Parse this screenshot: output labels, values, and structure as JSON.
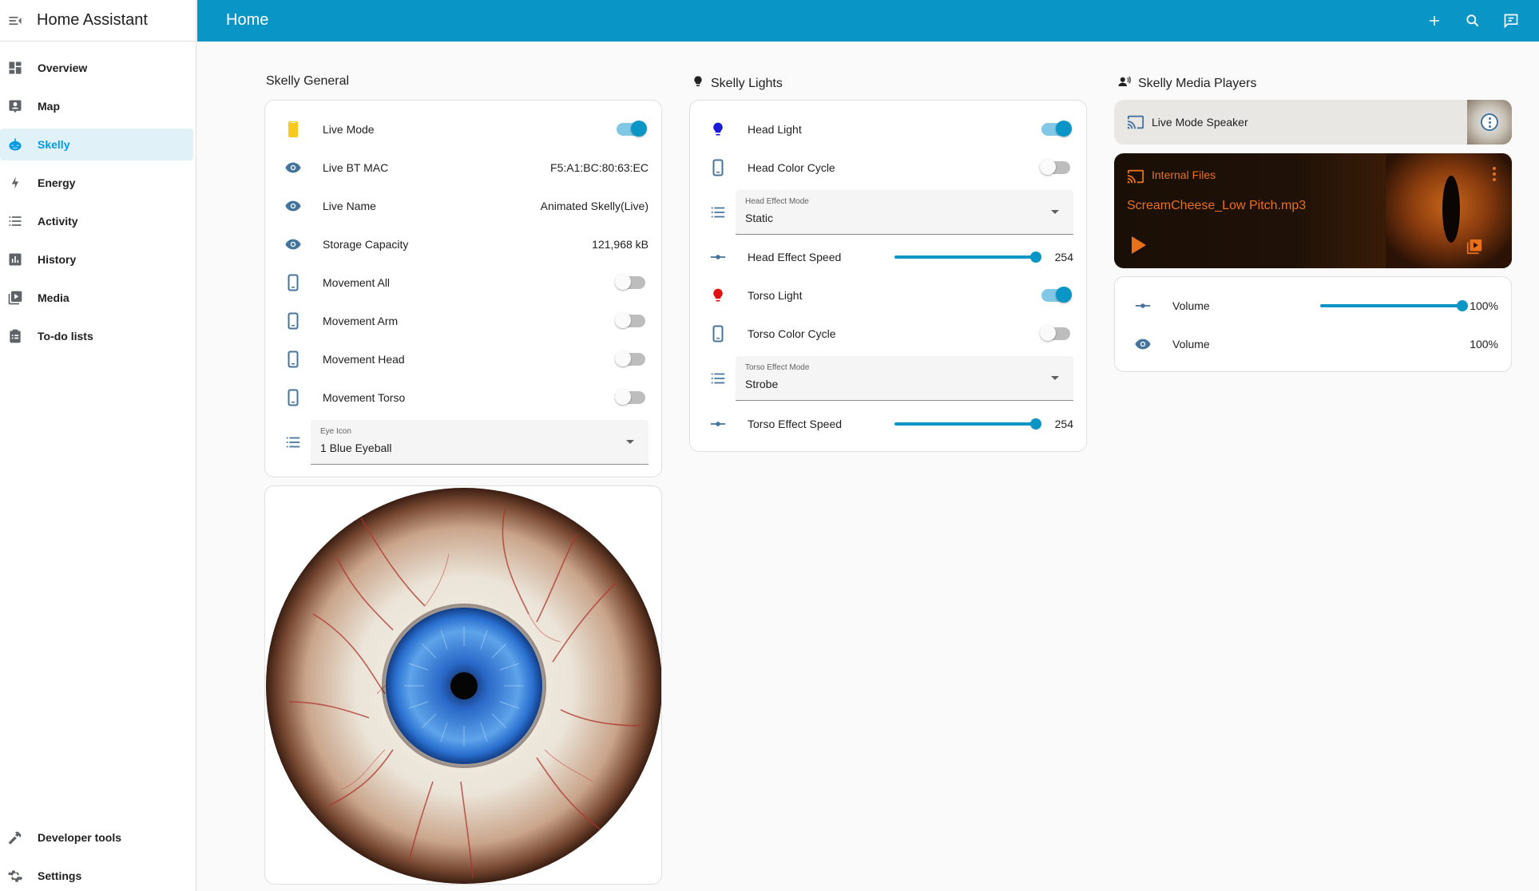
{
  "app": {
    "title": "Home Assistant"
  },
  "header": {
    "title": "Home"
  },
  "sidebar": {
    "items": [
      {
        "label": "Overview",
        "icon": "view-dashboard-icon"
      },
      {
        "label": "Map",
        "icon": "map-account-icon"
      },
      {
        "label": "Skelly",
        "icon": "pumpkin-icon",
        "active": true
      },
      {
        "label": "Energy",
        "icon": "lightning-bolt-icon"
      },
      {
        "label": "Activity",
        "icon": "format-list-bulleted-icon"
      },
      {
        "label": "History",
        "icon": "chart-box-icon"
      },
      {
        "label": "Media",
        "icon": "play-box-multiple-icon"
      },
      {
        "label": "To-do lists",
        "icon": "clipboard-list-icon"
      }
    ],
    "bottom": [
      {
        "label": "Developer tools",
        "icon": "hammer-icon"
      },
      {
        "label": "Settings",
        "icon": "cog-icon"
      }
    ]
  },
  "general": {
    "title": "Skelly General",
    "rows": [
      {
        "name": "Live Mode",
        "type": "toggle",
        "state": "on"
      },
      {
        "name": "Live BT MAC",
        "type": "value",
        "value": "F5:A1:BC:80:63:EC"
      },
      {
        "name": "Live Name",
        "type": "value",
        "value": "Animated Skelly(Live)"
      },
      {
        "name": "Storage Capacity",
        "type": "value",
        "value": "121,968 kB"
      },
      {
        "name": "Movement All",
        "type": "toggle",
        "state": "off"
      },
      {
        "name": "Movement Arm",
        "type": "toggle",
        "state": "off"
      },
      {
        "name": "Movement Head",
        "type": "toggle",
        "state": "off"
      },
      {
        "name": "Movement Torso",
        "type": "toggle",
        "state": "off"
      }
    ],
    "select": {
      "label": "Eye Icon",
      "value": "1 Blue Eyeball"
    }
  },
  "lights": {
    "title": "Skelly Lights",
    "head_light": "Head Light",
    "head_color_cycle": "Head Color Cycle",
    "head_effect_mode": {
      "label": "Head Effect Mode",
      "value": "Static"
    },
    "head_effect_speed": {
      "name": "Head Effect Speed",
      "value": "254",
      "level": 254,
      "max": 255
    },
    "torso_light": "Torso Light",
    "torso_color_cycle": "Torso Color Cycle",
    "torso_effect_mode": {
      "label": "Torso Effect Mode",
      "value": "Strobe"
    },
    "torso_effect_speed": {
      "name": "Torso Effect Speed",
      "value": "254",
      "level": 254,
      "max": 255
    },
    "colors": {
      "head": "#1a1ad8",
      "torso": "#e01010"
    }
  },
  "media": {
    "title": "Skelly Media Players",
    "speaker": "Live Mode Speaker",
    "source": "Internal Files",
    "track": "ScreamCheese_Low Pitch.mp3",
    "volume_slider": {
      "name": "Volume",
      "value": "100%",
      "level": 1.0
    },
    "volume_sensor": {
      "name": "Volume",
      "value": "100%"
    }
  },
  "colors": {
    "accent": "#0a95c7",
    "media_accent": "#e8701a"
  }
}
